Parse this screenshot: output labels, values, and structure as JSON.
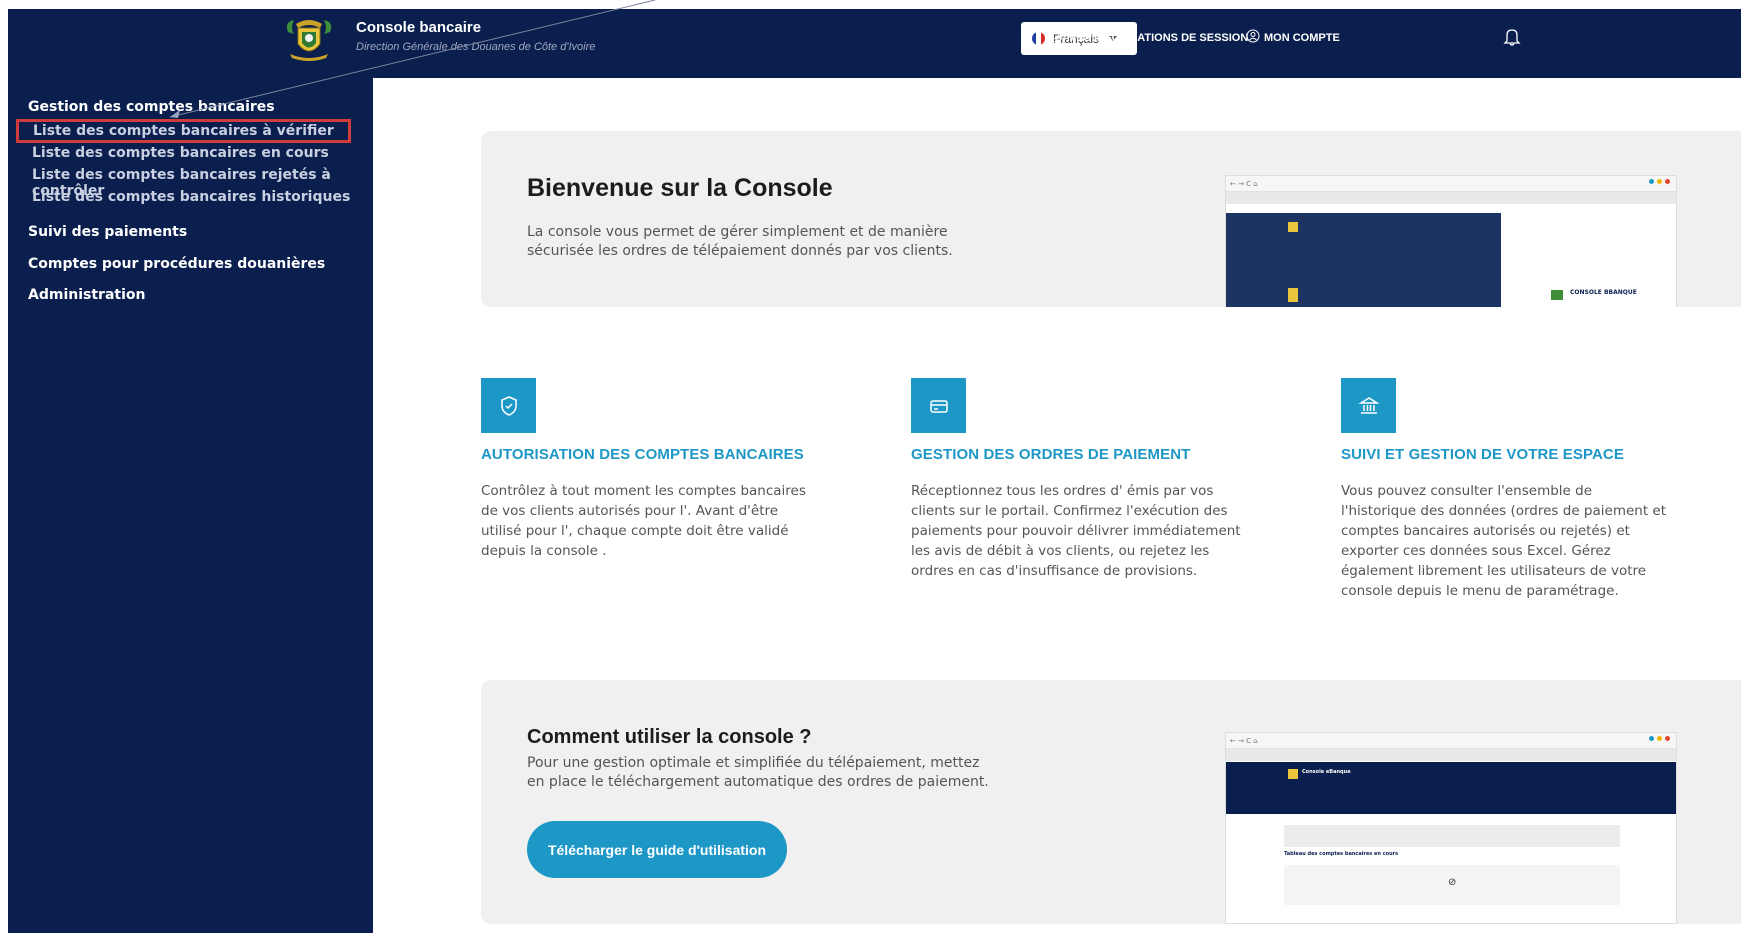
{
  "header": {
    "app_title": "Console bancaire",
    "app_subtitle": "Direction Générale des Douanes de Côte d'Ivoire",
    "language": "Français",
    "session_link": "MES INFORMATIONS DE SESSION",
    "account_link": "MON COMPTE"
  },
  "sidebar": {
    "sections": [
      {
        "label": "Gestion des comptes bancaires"
      },
      {
        "label": "Suivi des paiements"
      },
      {
        "label": "Comptes pour procédures douanières"
      },
      {
        "label": "Administration"
      }
    ],
    "subitems": [
      {
        "label": "Liste des comptes bancaires à vérifier",
        "active": true
      },
      {
        "label": "Liste des comptes bancaires en cours"
      },
      {
        "label": "Liste des comptes bancaires rejetés à contrôler"
      },
      {
        "label": "Liste des comptes bancaires historiques"
      }
    ]
  },
  "welcome": {
    "title": "Bienvenue sur la Console",
    "text": "La console vous permet de gérer simplement et de manière sécurisée les ordres de télépaiement donnés par vos clients.",
    "preview_label": "CONSOLE BBANQUE"
  },
  "features": [
    {
      "icon": "shield-icon",
      "title": "AUTORISATION DES COMPTES BANCAIRES",
      "text": "Contrôlez à tout moment les comptes bancaires de vos clients autorisés pour l'. Avant d'être utilisé pour l', chaque compte doit être validé depuis la console ."
    },
    {
      "icon": "card-icon",
      "title": "GESTION DES ORDRES DE PAIEMENT",
      "text": "Réceptionnez tous les ordres d' émis par vos clients sur le portail. Confirmez l'exécution des paiements pour pouvoir délivrer immédiatement les avis de débit à vos clients, ou rejetez les ordres en cas d'insuffisance de provisions."
    },
    {
      "icon": "bank-icon",
      "title": "SUIVI ET GESTION DE VOTRE ESPACE",
      "text": "Vous pouvez consulter l'ensemble de l'historique des données (ordres de paiement et comptes bancaires autorisés ou rejetés) et exporter ces données sous Excel. Gérez également librement les utilisateurs de votre console depuis le menu de paramétrage."
    }
  ],
  "guide": {
    "title": "Comment utiliser la console ?",
    "text": "Pour une gestion optimale et simplifiée du télépaiement, mettez en place le téléchargement automatique des ordres de paiement.",
    "button": "Télécharger le guide d'utilisation",
    "preview_label": "Console eBanque",
    "preview_table_title": "Tableau des comptes bancaires en cours"
  },
  "colors": {
    "navy": "#0b1f4e",
    "accent": "#1d97c6",
    "highlight": "#d03c3c",
    "card_bg": "#f0f0f0"
  }
}
